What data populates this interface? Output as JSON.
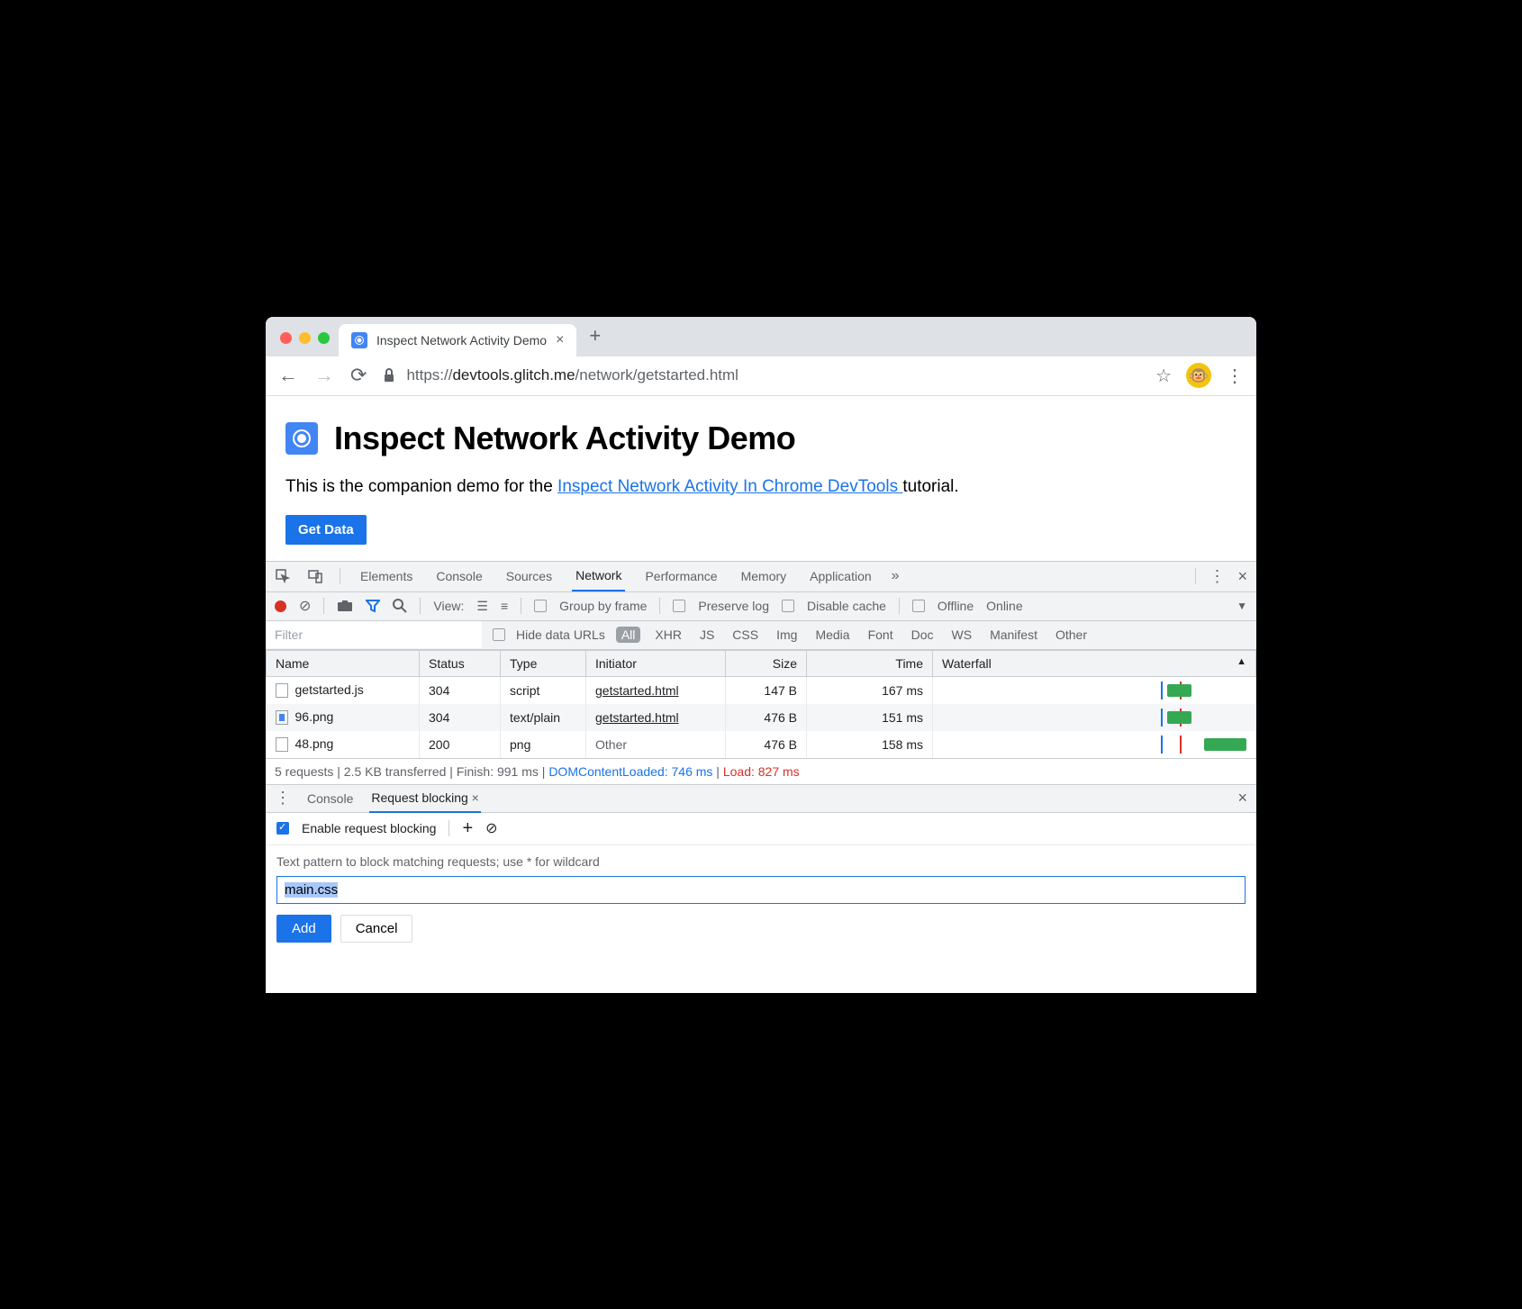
{
  "browser": {
    "tab_title": "Inspect Network Activity Demo",
    "url_scheme": "https://",
    "url_host": "devtools.glitch.me",
    "url_path": "/network/getstarted.html"
  },
  "page": {
    "heading": "Inspect Network Activity Demo",
    "desc_pre": "This is the companion demo for the ",
    "desc_link": "Inspect Network Activity In Chrome DevTools ",
    "desc_post": "tutorial.",
    "get_data": "Get Data"
  },
  "devtools": {
    "tabs": {
      "elements": "Elements",
      "console": "Console",
      "sources": "Sources",
      "network": "Network",
      "performance": "Performance",
      "memory": "Memory",
      "application": "Application"
    },
    "toolbar": {
      "view": "View:",
      "group_by_frame": "Group by frame",
      "preserve_log": "Preserve log",
      "disable_cache": "Disable cache",
      "offline": "Offline",
      "online": "Online"
    },
    "filter": {
      "placeholder": "Filter",
      "hide_data": "Hide data URLs",
      "types": {
        "all": "All",
        "xhr": "XHR",
        "js": "JS",
        "css": "CSS",
        "img": "Img",
        "media": "Media",
        "font": "Font",
        "doc": "Doc",
        "ws": "WS",
        "manifest": "Manifest",
        "other": "Other"
      }
    },
    "columns": {
      "name": "Name",
      "status": "Status",
      "type": "Type",
      "initiator": "Initiator",
      "size": "Size",
      "time": "Time",
      "waterfall": "Waterfall"
    },
    "rows": [
      {
        "name": "getstarted.js",
        "status": "304",
        "type": "script",
        "initiator": "getstarted.html",
        "size": "147 B",
        "time": "167 ms"
      },
      {
        "name": "96.png",
        "status": "304",
        "type": "text/plain",
        "initiator": "getstarted.html",
        "size": "476 B",
        "time": "151 ms"
      },
      {
        "name": "48.png",
        "status": "200",
        "type": "png",
        "initiator": "Other",
        "size": "476 B",
        "time": "158 ms"
      }
    ],
    "summary": {
      "requests": "5 requests",
      "transferred": "2.5 KB transferred",
      "finish": "Finish: 991 ms",
      "dcl": "DOMContentLoaded: 746 ms",
      "load": "Load: 827 ms"
    }
  },
  "drawer": {
    "tabs": {
      "console": "Console",
      "request_blocking": "Request blocking"
    },
    "enable": "Enable request blocking",
    "hint": "Text pattern to block matching requests; use * for wildcard",
    "input_value": "main.css",
    "add": "Add",
    "cancel": "Cancel"
  }
}
